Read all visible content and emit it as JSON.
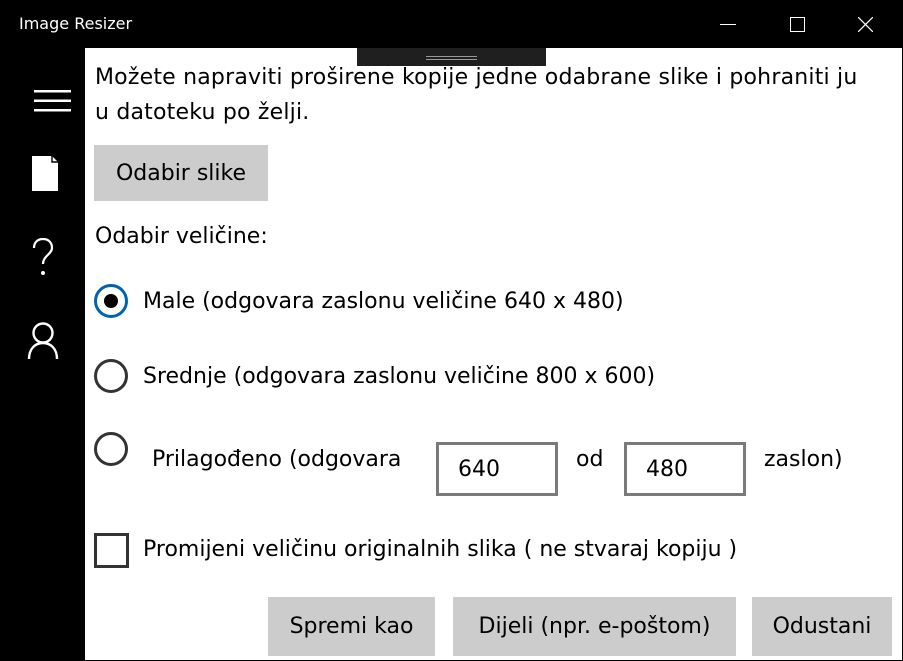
{
  "window": {
    "title": "Image Resizer"
  },
  "titlebar": {
    "minimize_icon": "minimize-icon",
    "maximize_icon": "maximize-icon",
    "close_icon": "close-icon"
  },
  "nav": {
    "items": [
      {
        "icon": "hamburger-menu-icon"
      },
      {
        "icon": "document-icon"
      },
      {
        "icon": "help-question-icon"
      },
      {
        "icon": "user-person-icon"
      }
    ]
  },
  "content": {
    "description_line1": "Možete napraviti proširene kopije jedne odabrane slike i pohraniti ju",
    "description_line2": "u datoteku po želji.",
    "select_image_button": "Odabir slike",
    "size_label": "Odabir veličine:",
    "options": {
      "small": "Male (odgovara zaslonu veličine 640 x 480)",
      "medium": "Srednje (odgovara zaslonu veličine 800 x 600)",
      "custom_prefix": "Prilagođeno (odgovara",
      "custom_width": "640",
      "custom_separator": "od",
      "custom_height": "480",
      "custom_suffix": "zaslon)"
    },
    "selected_option": "small",
    "resize_original_label": "Promijeni veličinu originalnih slika ( ne stvaraj kopiju )",
    "resize_original_checked": false
  },
  "footer": {
    "save_as": "Spremi kao",
    "share": "Dijeli (npr. e-poštom)",
    "cancel": "Odustani"
  },
  "colors": {
    "accent": "#0063b1",
    "button_bg": "#cccccc",
    "chrome_bg": "#000000"
  }
}
